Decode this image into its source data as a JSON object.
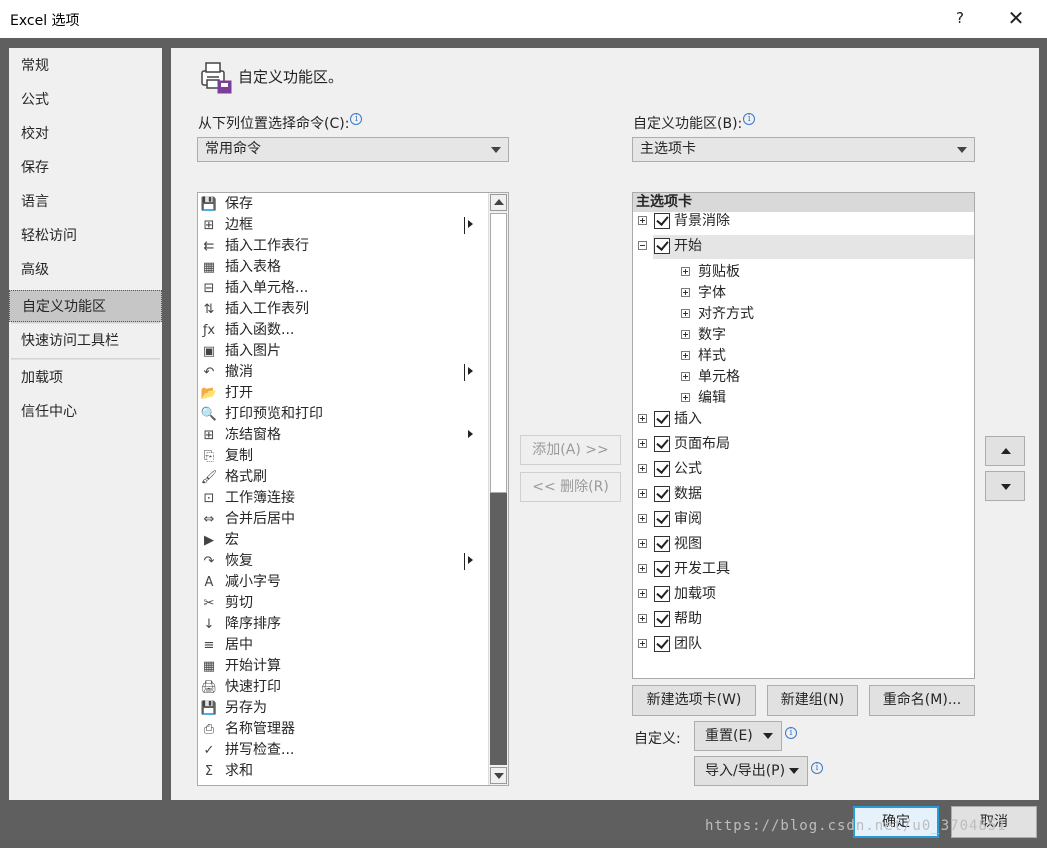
{
  "window": {
    "title": "Excel 选项",
    "help_label": "?",
    "close_label": "✕"
  },
  "nav": {
    "items": [
      {
        "label": "常规",
        "selected": false
      },
      {
        "label": "公式",
        "selected": false
      },
      {
        "label": "校对",
        "selected": false
      },
      {
        "label": "保存",
        "selected": false
      },
      {
        "label": "语言",
        "selected": false
      },
      {
        "label": "轻松访问",
        "selected": false
      },
      {
        "label": "高级",
        "selected": false
      },
      {
        "label": "自定义功能区",
        "selected": true
      },
      {
        "label": "快速访问工具栏",
        "selected": false
      },
      {
        "label": "加载项",
        "selected": false
      },
      {
        "label": "信任中心",
        "selected": false
      }
    ]
  },
  "header": {
    "title": "自定义功能区。"
  },
  "commands": {
    "label": "从下列位置选择命令(C):",
    "source": "常用命令",
    "items": [
      {
        "label": "保存",
        "icon": "save-icon",
        "glyph": "💾",
        "submenu": false
      },
      {
        "label": "边框",
        "icon": "border-icon",
        "glyph": "⊞",
        "submenu": true
      },
      {
        "label": "插入工作表行",
        "icon": "insert-row-icon",
        "glyph": "⇇",
        "submenu": false
      },
      {
        "label": "插入表格",
        "icon": "table-icon",
        "glyph": "▦",
        "submenu": false
      },
      {
        "label": "插入单元格...",
        "icon": "insert-cell-icon",
        "glyph": "⊟",
        "submenu": false
      },
      {
        "label": "插入工作表列",
        "icon": "insert-column-icon",
        "glyph": "⇅",
        "submenu": false
      },
      {
        "label": "插入函数...",
        "icon": "function-icon",
        "glyph": "ƒx",
        "submenu": false
      },
      {
        "label": "插入图片",
        "icon": "picture-icon",
        "glyph": "▣",
        "submenu": false
      },
      {
        "label": "撤消",
        "icon": "undo-icon",
        "glyph": "↶",
        "submenu": true
      },
      {
        "label": "打开",
        "icon": "folder-icon",
        "glyph": "📂",
        "submenu": false
      },
      {
        "label": "打印预览和打印",
        "icon": "print-preview-icon",
        "glyph": "🔍",
        "submenu": false
      },
      {
        "label": "冻结窗格",
        "icon": "freeze-panes-icon",
        "glyph": "⊞",
        "submenu": true
      },
      {
        "label": "复制",
        "icon": "copy-icon",
        "glyph": "⎘",
        "submenu": false
      },
      {
        "label": "格式刷",
        "icon": "format-painter-icon",
        "glyph": "🖌",
        "submenu": false
      },
      {
        "label": "工作簿连接",
        "icon": "connection-icon",
        "glyph": "⊡",
        "submenu": false
      },
      {
        "label": "合并后居中",
        "icon": "merge-center-icon",
        "glyph": "⇔",
        "submenu": false
      },
      {
        "label": "宏",
        "icon": "macro-icon",
        "glyph": "▶",
        "submenu": false
      },
      {
        "label": "恢复",
        "icon": "redo-icon",
        "glyph": "↷",
        "submenu": true
      },
      {
        "label": "减小字号",
        "icon": "decrease-font-icon",
        "glyph": "A",
        "submenu": false
      },
      {
        "label": "剪切",
        "icon": "cut-icon",
        "glyph": "✂",
        "submenu": false
      },
      {
        "label": "降序排序",
        "icon": "sort-desc-icon",
        "glyph": "↓",
        "submenu": false
      },
      {
        "label": "居中",
        "icon": "center-align-icon",
        "glyph": "≡",
        "submenu": false
      },
      {
        "label": "开始计算",
        "icon": "calculator-icon",
        "glyph": "▦",
        "submenu": false
      },
      {
        "label": "快速打印",
        "icon": "quick-print-icon",
        "glyph": "🖨",
        "submenu": false
      },
      {
        "label": "另存为",
        "icon": "save-as-icon",
        "glyph": "💾",
        "submenu": false
      },
      {
        "label": "名称管理器",
        "icon": "name-manager-icon",
        "glyph": "⎙",
        "submenu": false
      },
      {
        "label": "拼写检查...",
        "icon": "spelling-icon",
        "glyph": "✓",
        "submenu": false
      },
      {
        "label": "求和",
        "icon": "sum-icon",
        "glyph": "Σ",
        "submenu": false
      }
    ]
  },
  "transfer": {
    "add_label": "添加(A) >>",
    "remove_label": "<< 删除(R)"
  },
  "ribbon": {
    "label": "自定义功能区(B):",
    "target": "主选项卡",
    "tree_header": "主选项卡",
    "rows": [
      {
        "label": "背景消除",
        "level": 0,
        "expanded": false,
        "checked": true,
        "selected": false
      },
      {
        "label": "开始",
        "level": 0,
        "expanded": true,
        "checked": true,
        "selected": true
      },
      {
        "label": "剪贴板",
        "level": 1,
        "expanded": false,
        "checked": false,
        "selected": false
      },
      {
        "label": "字体",
        "level": 1,
        "expanded": false,
        "checked": false,
        "selected": false
      },
      {
        "label": "对齐方式",
        "level": 1,
        "expanded": false,
        "checked": false,
        "selected": false
      },
      {
        "label": "数字",
        "level": 1,
        "expanded": false,
        "checked": false,
        "selected": false
      },
      {
        "label": "样式",
        "level": 1,
        "expanded": false,
        "checked": false,
        "selected": false
      },
      {
        "label": "单元格",
        "level": 1,
        "expanded": false,
        "checked": false,
        "selected": false
      },
      {
        "label": "编辑",
        "level": 1,
        "expanded": false,
        "checked": false,
        "selected": false
      },
      {
        "label": "插入",
        "level": 0,
        "expanded": false,
        "checked": true,
        "selected": false
      },
      {
        "label": "页面布局",
        "level": 0,
        "expanded": false,
        "checked": true,
        "selected": false
      },
      {
        "label": "公式",
        "level": 0,
        "expanded": false,
        "checked": true,
        "selected": false
      },
      {
        "label": "数据",
        "level": 0,
        "expanded": false,
        "checked": true,
        "selected": false
      },
      {
        "label": "审阅",
        "level": 0,
        "expanded": false,
        "checked": true,
        "selected": false
      },
      {
        "label": "视图",
        "level": 0,
        "expanded": false,
        "checked": true,
        "selected": false
      },
      {
        "label": "开发工具",
        "level": 0,
        "expanded": false,
        "checked": true,
        "selected": false
      },
      {
        "label": "加载项",
        "level": 0,
        "expanded": false,
        "checked": true,
        "selected": false
      },
      {
        "label": "帮助",
        "level": 0,
        "expanded": false,
        "checked": true,
        "selected": false
      },
      {
        "label": "团队",
        "level": 0,
        "expanded": false,
        "checked": true,
        "selected": false
      }
    ],
    "new_tab_label": "新建选项卡(W)",
    "new_group_label": "新建组(N)",
    "rename_label": "重命名(M)...",
    "customize_label": "自定义:",
    "reset_label": "重置(E)",
    "import_export_label": "导入/导出(P)"
  },
  "footer": {
    "ok_label": "确定",
    "cancel_label": "取消",
    "watermark": "https://blog.csdn.net/u0_3704851"
  },
  "colors": {
    "accent": "#2a9ad7",
    "frame": "#5f5f5f",
    "panel": "#f0f0f0",
    "nav_selected": "#c6c6c6"
  }
}
